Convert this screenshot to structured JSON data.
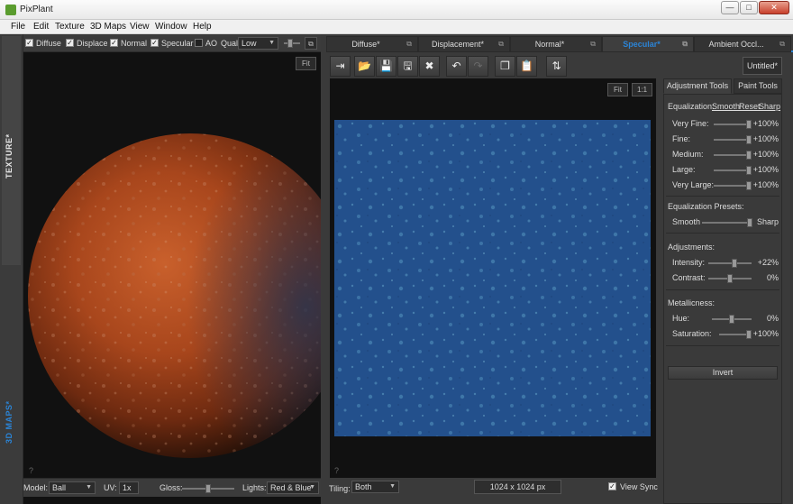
{
  "window": {
    "title": "PixPlant",
    "min": "—",
    "max": "□",
    "close": "✕"
  },
  "menu": [
    "File",
    "Edit",
    "Texture",
    "3D Maps",
    "View",
    "Window",
    "Help"
  ],
  "side_labels": {
    "texture": "TEXTURE*",
    "maps": "3D MAPS*"
  },
  "left_toolbar": {
    "checks": [
      {
        "label": "Diffuse",
        "checked": true
      },
      {
        "label": "Displacen",
        "checked": true
      },
      {
        "label": "Normal",
        "checked": true
      },
      {
        "label": "Specular",
        "checked": true
      },
      {
        "label": "AO",
        "checked": false
      }
    ],
    "qual_label": "Qual",
    "qual_value": "Low",
    "fit": "Fit"
  },
  "left_bottom": {
    "model_label": "Model:",
    "model_value": "Ball",
    "uv_label": "UV:",
    "uv_value": "1x",
    "gloss_label": "Gloss:",
    "lights_label": "Lights:",
    "lights_value": "Red & Blue",
    "help": "?"
  },
  "tabs": [
    {
      "label": "Diffuse*",
      "active": false
    },
    {
      "label": "Displacement*",
      "active": false
    },
    {
      "label": "Normal*",
      "active": false
    },
    {
      "label": "Specular*",
      "active": true
    },
    {
      "label": "Ambient Occl...",
      "active": false
    }
  ],
  "toolbar_icons": [
    "import-icon",
    "open-folder-icon",
    "save-icon",
    "save-as-icon",
    "delete-icon",
    "undo-icon",
    "redo-icon",
    "copy-icon",
    "paste-icon",
    "swap-icon"
  ],
  "untitled": "Untitled*",
  "viewport": {
    "fit": "Fit",
    "one_to_one": "1:1",
    "help": "?"
  },
  "bottom2": {
    "tiling_label": "Tiling:",
    "tiling_value": "Both",
    "size": "1024 x 1024 px",
    "view_sync": "View Sync"
  },
  "adjust": {
    "tab_adjust": "Adjustment Tools",
    "tab_paint": "Paint Tools",
    "equalization_label": "Equalization:",
    "eq_links": [
      "Smooth",
      "Reset",
      "Sharp"
    ],
    "eq_rows": [
      {
        "label": "Very Fine:",
        "value": "+100%",
        "level": 1.0
      },
      {
        "label": "Fine:",
        "value": "+100%",
        "level": 1.0
      },
      {
        "label": "Medium:",
        "value": "+100%",
        "level": 1.0
      },
      {
        "label": "Large:",
        "value": "+100%",
        "level": 1.0
      },
      {
        "label": "Very Large:",
        "value": "+100%",
        "level": 1.0
      }
    ],
    "presets_label": "Equalization Presets:",
    "presets_left": "Smooth",
    "presets_right": "Sharp",
    "adjustments_label": "Adjustments:",
    "adj_rows": [
      {
        "label": "Intensity:",
        "value": "+22%",
        "level": 0.61
      },
      {
        "label": "Contrast:",
        "value": "0%",
        "level": 0.5
      }
    ],
    "metal_label": "Metallicness:",
    "metal_rows": [
      {
        "label": "Hue:",
        "value": "0%",
        "level": 0.5
      },
      {
        "label": "Saturation:",
        "value": "+100%",
        "level": 1.0
      }
    ],
    "invert": "Invert"
  },
  "colors": {
    "accent": "#2b84d6",
    "sphere": "#a8461c",
    "texture": "#23508c"
  }
}
